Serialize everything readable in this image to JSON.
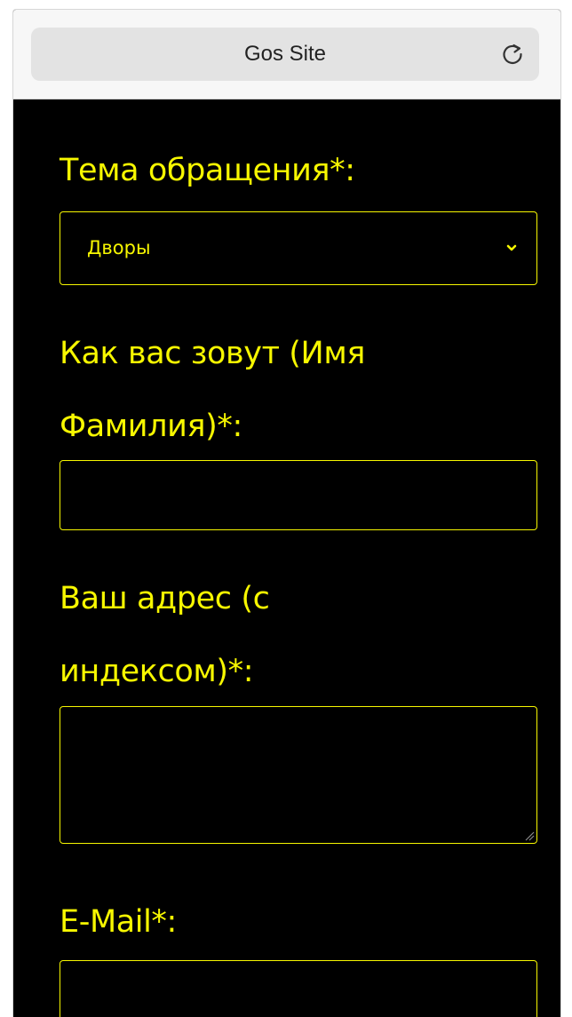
{
  "browser": {
    "title": "Gos Site",
    "reload_icon": "reload-icon"
  },
  "form": {
    "topic": {
      "label": "Тема обращения*:",
      "selected": "Дворы",
      "icon": "chevron-down-icon"
    },
    "name": {
      "label_line1": "Как вас зовут (Имя",
      "label_line2": "Фамилия)*:",
      "value": ""
    },
    "address": {
      "label_line1": "Ваш адрес (с",
      "label_line2": "индексом)*:",
      "value": ""
    },
    "email": {
      "label": "E-Mail*:",
      "value": ""
    }
  },
  "colors": {
    "background": "#000000",
    "accent": "#f7f700",
    "chrome": "#f7f7f7"
  }
}
